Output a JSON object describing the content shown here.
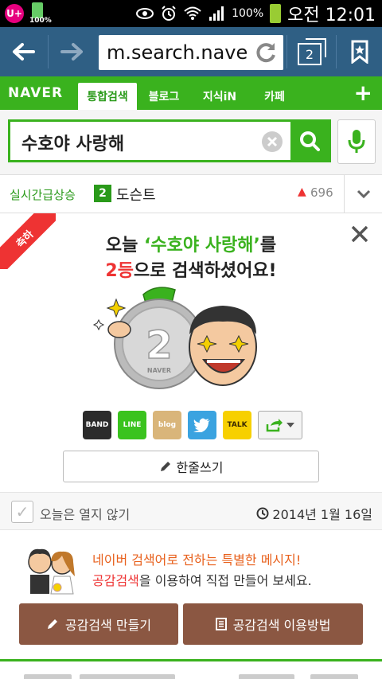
{
  "status_bar": {
    "carrier_logo": "U+",
    "small_battery_label": "100%",
    "battery_percent": "100%",
    "clock": "오전 12:01",
    "icons": [
      "eye-icon",
      "alarm-icon",
      "wifi-icon",
      "signal-icon",
      "battery-icon"
    ]
  },
  "browser": {
    "url": "m.search.naver.com",
    "tab_count": "2"
  },
  "naver_nav": {
    "logo": "NAVER",
    "tabs": [
      {
        "label": "통합검색",
        "active": true
      },
      {
        "label": "블로그",
        "active": false
      },
      {
        "label": "지식iN",
        "active": false
      },
      {
        "label": "카페",
        "active": false
      }
    ],
    "plus": "+"
  },
  "search": {
    "query": "수호야 사랑해"
  },
  "trending": {
    "label": "실시간급상승",
    "rank": "2",
    "word": "도슨트",
    "count": "696"
  },
  "congrats": {
    "ribbon": "축하",
    "headline": {
      "prefix": "오늘 ",
      "quote": "‘수호야 사랑해’",
      "suffix": "를",
      "rank": "2등",
      "rest": "으로 검색하셨어요!"
    },
    "coin_number": "2",
    "coin_brand": "NAVER",
    "share_icons": [
      {
        "name": "band",
        "label": "BAND",
        "color": "#2b2b2b"
      },
      {
        "name": "line",
        "label": "LINE",
        "color": "#3ac31e"
      },
      {
        "name": "blog",
        "label": "blog",
        "color": "#d9b57a"
      },
      {
        "name": "twitter",
        "label": "",
        "color": "#3aa3e0"
      },
      {
        "name": "kakaotalk",
        "label": "TALK",
        "color": "#f7d000"
      }
    ],
    "write_label": "한줄쓰기",
    "dont_open_label": "오늘은 열지 않기",
    "date": "2014년 1월 16일"
  },
  "promo": {
    "line1": "네이버 검색어로 전하는 특별한 메시지!",
    "line2_highlight": "공감검색",
    "line2_rest": "을 이용하여 직접 만들어 보세요.",
    "btn_make": "공감검색 만들기",
    "btn_howto": "공감검색 이용방법"
  },
  "colors": {
    "naver_green": "#3ab21e",
    "browser_blue": "#2f5f84",
    "promo_brown": "#8b5742",
    "highlight_red": "#e33333",
    "promo_orange": "#e8601c"
  }
}
